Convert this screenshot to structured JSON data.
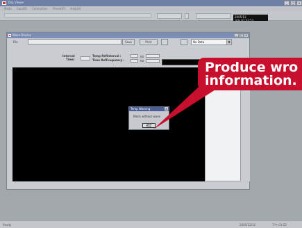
{
  "titlebar": {
    "title": "Dsp Viewer"
  },
  "menubar": {
    "items": [
      "Mode",
      "Input(I)",
      "Connection",
      "Preset(P)",
      "Help(H)"
    ]
  },
  "toolbar": {
    "clock_lines": [
      "2005/12",
      "下午 01:22:52"
    ]
  },
  "child_window": {
    "title": "Wave Display",
    "file_label": "File",
    "save_label": "Save",
    "print_label": "Print",
    "source_combo": "No Data",
    "interval_label": "Interval\nTime:",
    "temp_label": "Temp RefInterval :",
    "time_label": "Time RefFrequency :",
    "unit_hz": "Hz"
  },
  "dialog": {
    "title": "Temp Warning",
    "message": "Block without wave",
    "ok_label": "確定",
    "close_glyph": "x"
  },
  "callout": {
    "lines": [
      "Produce wro",
      "information."
    ]
  },
  "statusbar": {
    "left": "Ready",
    "right_date": "2005/12/12",
    "right_time": "下午 01:22"
  },
  "window_controls": {
    "minimize": "_",
    "maximize": "□",
    "close": "x"
  },
  "colors": {
    "callout": "#c8102e",
    "titlebar": "#6e7fa6",
    "plot_bg": "#000000"
  }
}
